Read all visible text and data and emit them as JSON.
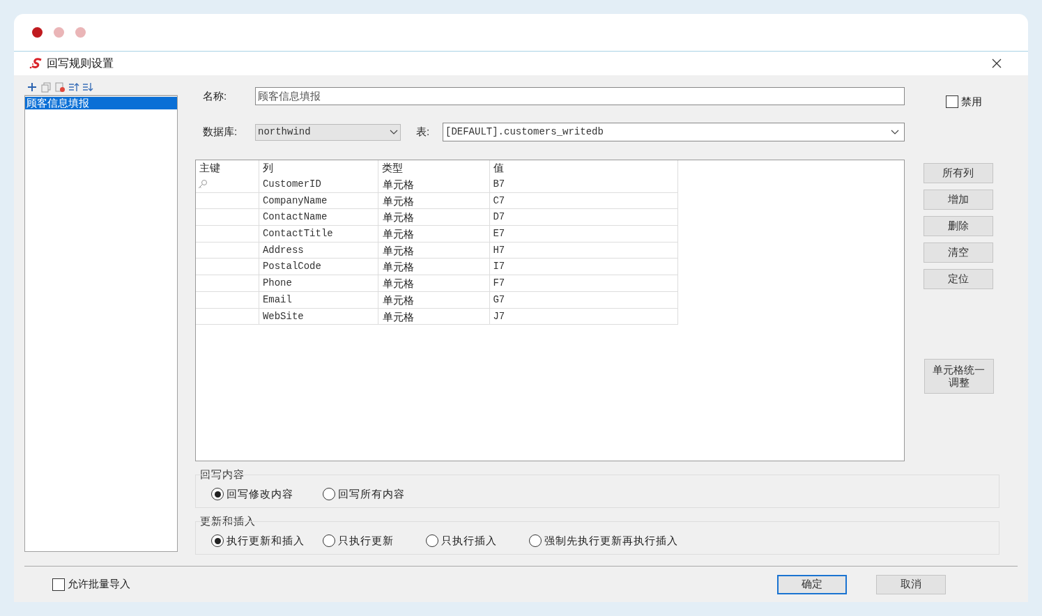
{
  "window": {
    "title": "回写规则设置"
  },
  "rules": [
    {
      "label": "顾客信息填报",
      "selected": true
    }
  ],
  "form": {
    "name": {
      "label": "名称:",
      "value": "顾客信息填报"
    },
    "disabled": {
      "label": "禁用",
      "checked": false
    },
    "database": {
      "label": "数据库:",
      "value": "northwind"
    },
    "table": {
      "label": "表:",
      "value": "[DEFAULT].customers_writedb"
    }
  },
  "grid": {
    "columns": [
      "主键",
      "列",
      "类型",
      "值"
    ],
    "rows": [
      {
        "primary_key": true,
        "column": "CustomerID",
        "type": "单元格",
        "value": "B7"
      },
      {
        "primary_key": false,
        "column": "CompanyName",
        "type": "单元格",
        "value": "C7"
      },
      {
        "primary_key": false,
        "column": "ContactName",
        "type": "单元格",
        "value": "D7"
      },
      {
        "primary_key": false,
        "column": "ContactTitle",
        "type": "单元格",
        "value": "E7"
      },
      {
        "primary_key": false,
        "column": "Address",
        "type": "单元格",
        "value": "H7"
      },
      {
        "primary_key": false,
        "column": "PostalCode",
        "type": "单元格",
        "value": "I7"
      },
      {
        "primary_key": false,
        "column": "Phone",
        "type": "单元格",
        "value": "F7"
      },
      {
        "primary_key": false,
        "column": "Email",
        "type": "单元格",
        "value": "G7"
      },
      {
        "primary_key": false,
        "column": "WebSite",
        "type": "单元格",
        "value": "J7"
      }
    ]
  },
  "side_buttons": [
    "所有列",
    "增加",
    "删除",
    "清空",
    "定位"
  ],
  "adjust_button": "单元格统一调整",
  "groups": [
    {
      "title": "回写内容",
      "options": [
        {
          "label": "回写修改内容",
          "selected": true
        },
        {
          "label": "回写所有内容",
          "selected": false
        }
      ]
    },
    {
      "title": "更新和插入",
      "options": [
        {
          "label": "执行更新和插入",
          "selected": true
        },
        {
          "label": "只执行更新",
          "selected": false
        },
        {
          "label": "只执行插入",
          "selected": false
        },
        {
          "label": "强制先执行更新再执行插入",
          "selected": false
        }
      ]
    }
  ],
  "footer": {
    "batch_import": {
      "label": "允许批量导入",
      "checked": false
    },
    "buttons": [
      {
        "label": "确定",
        "default": true
      },
      {
        "label": "取消",
        "default": false
      }
    ]
  }
}
